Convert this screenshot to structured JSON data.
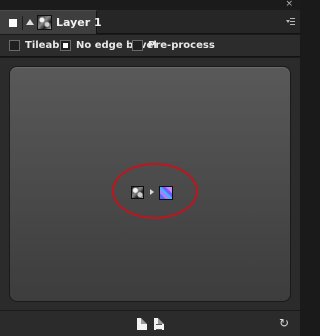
{
  "window": {
    "close_glyph": "×"
  },
  "tab": {
    "label": "Layer 1",
    "icons": [
      "visibility-square-icon",
      "collapse-arrow-icon",
      "layer-thumbnail-icon"
    ]
  },
  "panel_menu": {
    "icon": "panel-menu-icon"
  },
  "options": [
    {
      "label": "Tileable",
      "checked": false
    },
    {
      "label": "No edge bevel",
      "checked": true
    },
    {
      "label": "Pre-process",
      "checked": false
    }
  ],
  "preview": {
    "source_icon": "source-texture-icon",
    "arrow_icon": "arrow-right-icon",
    "result_icon": "normal-map-icon",
    "annotation_color": "#c1141c"
  },
  "footer": {
    "icons": [
      "new-document-icon",
      "duplicate-document-icon",
      "refresh-icon"
    ],
    "refresh_glyph": "↻"
  },
  "colors": {
    "background": "#2b2b2b",
    "panel": "#4f4f4f",
    "accent": "#c1141c"
  }
}
